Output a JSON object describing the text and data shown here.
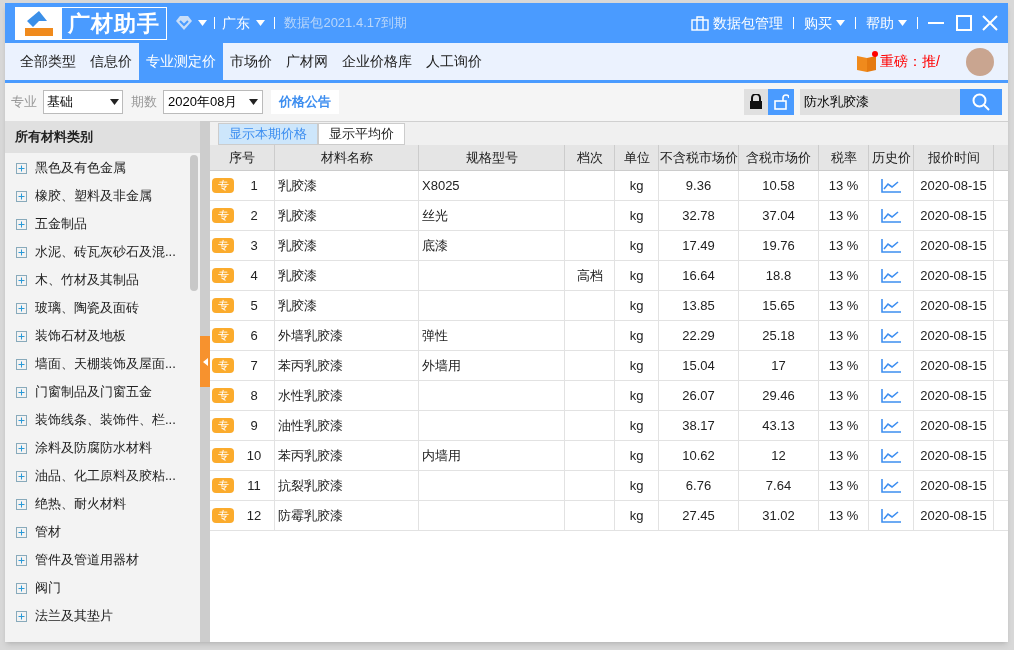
{
  "title_bar": {
    "app_name": "广材助手",
    "region": "广东",
    "expiry": "数据包2021.4.17到期",
    "menu": [
      {
        "label": "数据包管理",
        "kind": "package"
      },
      {
        "label": "购买",
        "kind": "dropdown"
      },
      {
        "label": "帮助",
        "kind": "dropdown"
      }
    ]
  },
  "nav_tabs": [
    {
      "label": "全部类型",
      "selected": false
    },
    {
      "label": "信息价",
      "selected": false
    },
    {
      "label": "专业测定价",
      "selected": true
    },
    {
      "label": "市场价",
      "selected": false
    },
    {
      "label": "广材网",
      "selected": false
    },
    {
      "label": "企业价格库",
      "selected": false
    },
    {
      "label": "人工询价",
      "selected": false
    }
  ],
  "promo": {
    "text": "重磅：推/"
  },
  "toolbar": {
    "specialty_label": "专业",
    "specialty_value": "基础",
    "period_label": "期数",
    "period_value": "2020年08月",
    "notice_button": "价格公告",
    "search_value": "防水乳胶漆"
  },
  "sidebar": {
    "title": "所有材料类别",
    "items": [
      {
        "label": "黑色及有色金属"
      },
      {
        "label": "橡胶、塑料及非金属"
      },
      {
        "label": "五金制品"
      },
      {
        "label": "水泥、砖瓦灰砂石及混..."
      },
      {
        "label": "木、竹材及其制品"
      },
      {
        "label": "玻璃、陶瓷及面砖"
      },
      {
        "label": "装饰石材及地板"
      },
      {
        "label": "墙面、天棚装饰及屋面..."
      },
      {
        "label": "门窗制品及门窗五金"
      },
      {
        "label": "装饰线条、装饰件、栏..."
      },
      {
        "label": "涂料及防腐防水材料"
      },
      {
        "label": "油品、化工原料及胶粘..."
      },
      {
        "label": "绝热、耐火材料"
      },
      {
        "label": "管材"
      },
      {
        "label": "管件及管道用器材"
      },
      {
        "label": "阀门"
      },
      {
        "label": "法兰及其垫片"
      }
    ]
  },
  "view_tabs": [
    {
      "label": "显示本期价格",
      "selected": true
    },
    {
      "label": "显示平均价",
      "selected": false
    }
  ],
  "table": {
    "columns": [
      "序号",
      "材料名称",
      "规格型号",
      "档次",
      "单位",
      "不含税市场价",
      "含税市场价",
      "税率",
      "历史价",
      "报价时间"
    ],
    "rows": [
      {
        "badge": "专",
        "no": "1",
        "name": "乳胶漆",
        "spec": "X8025",
        "grade": "",
        "unit": "kg",
        "price_ex": "9.36",
        "price_in": "10.58",
        "tax": "13 %",
        "date": "2020-08-15"
      },
      {
        "badge": "专",
        "no": "2",
        "name": "乳胶漆",
        "spec": "丝光",
        "grade": "",
        "unit": "kg",
        "price_ex": "32.78",
        "price_in": "37.04",
        "tax": "13 %",
        "date": "2020-08-15"
      },
      {
        "badge": "专",
        "no": "3",
        "name": "乳胶漆",
        "spec": "底漆",
        "grade": "",
        "unit": "kg",
        "price_ex": "17.49",
        "price_in": "19.76",
        "tax": "13 %",
        "date": "2020-08-15"
      },
      {
        "badge": "专",
        "no": "4",
        "name": "乳胶漆",
        "spec": "",
        "grade": "高档",
        "unit": "kg",
        "price_ex": "16.64",
        "price_in": "18.8",
        "tax": "13 %",
        "date": "2020-08-15"
      },
      {
        "badge": "专",
        "no": "5",
        "name": "乳胶漆",
        "spec": "",
        "grade": "",
        "unit": "kg",
        "price_ex": "13.85",
        "price_in": "15.65",
        "tax": "13 %",
        "date": "2020-08-15"
      },
      {
        "badge": "专",
        "no": "6",
        "name": "外墙乳胶漆",
        "spec": "弹性",
        "grade": "",
        "unit": "kg",
        "price_ex": "22.29",
        "price_in": "25.18",
        "tax": "13 %",
        "date": "2020-08-15"
      },
      {
        "badge": "专",
        "no": "7",
        "name": "苯丙乳胶漆",
        "spec": "外墙用",
        "grade": "",
        "unit": "kg",
        "price_ex": "15.04",
        "price_in": "17",
        "tax": "13 %",
        "date": "2020-08-15"
      },
      {
        "badge": "专",
        "no": "8",
        "name": "水性乳胶漆",
        "spec": "",
        "grade": "",
        "unit": "kg",
        "price_ex": "26.07",
        "price_in": "29.46",
        "tax": "13 %",
        "date": "2020-08-15"
      },
      {
        "badge": "专",
        "no": "9",
        "name": "油性乳胶漆",
        "spec": "",
        "grade": "",
        "unit": "kg",
        "price_ex": "38.17",
        "price_in": "43.13",
        "tax": "13 %",
        "date": "2020-08-15"
      },
      {
        "badge": "专",
        "no": "10",
        "name": "苯丙乳胶漆",
        "spec": "内墙用",
        "grade": "",
        "unit": "kg",
        "price_ex": "10.62",
        "price_in": "12",
        "tax": "13 %",
        "date": "2020-08-15"
      },
      {
        "badge": "专",
        "no": "11",
        "name": "抗裂乳胶漆",
        "spec": "",
        "grade": "",
        "unit": "kg",
        "price_ex": "6.76",
        "price_in": "7.64",
        "tax": "13 %",
        "date": "2020-08-15"
      },
      {
        "badge": "专",
        "no": "12",
        "name": "防霉乳胶漆",
        "spec": "",
        "grade": "",
        "unit": "kg",
        "price_ex": "27.45",
        "price_in": "31.02",
        "tax": "13 %",
        "date": "2020-08-15"
      }
    ]
  }
}
